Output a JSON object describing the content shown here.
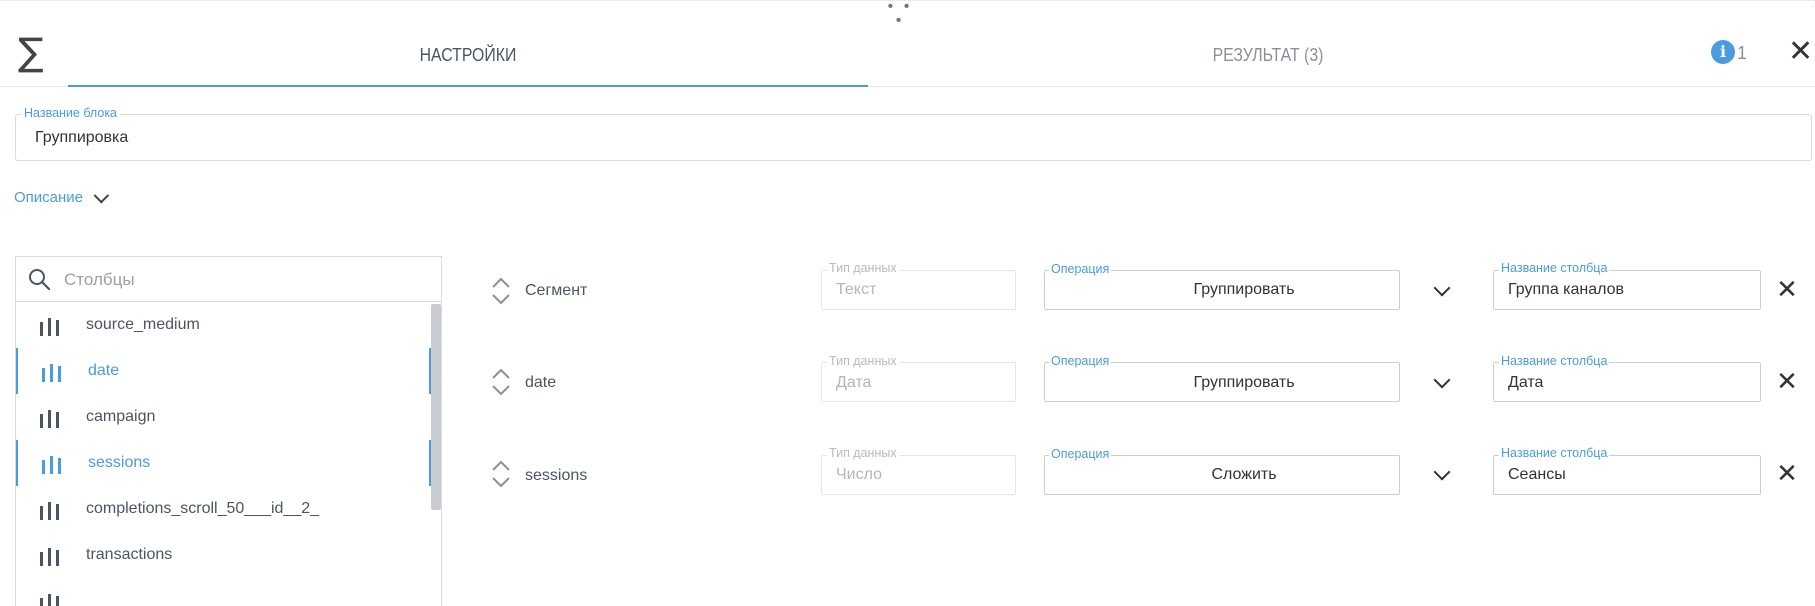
{
  "header": {
    "drag_handle": "• • •",
    "sigma_symbol": "∑",
    "tabs": [
      {
        "label": "НАСТРОЙКИ",
        "active": true
      },
      {
        "label": "РЕЗУЛЬТАТ (3)",
        "active": false
      }
    ],
    "info_count": "1",
    "close_symbol": "✕"
  },
  "block_name": {
    "label": "Название блока",
    "value": "Группировка"
  },
  "description": {
    "label": "Описание"
  },
  "columns": {
    "placeholder": "Столбцы",
    "items": [
      {
        "label": "source_medium",
        "selected": false
      },
      {
        "label": "date",
        "selected": true
      },
      {
        "label": "campaign",
        "selected": false
      },
      {
        "label": "sessions",
        "selected": true
      },
      {
        "label": "completions_scroll_50___id__2_",
        "selected": false
      },
      {
        "label": "transactions",
        "selected": false
      }
    ]
  },
  "rows": [
    {
      "name": "Сегмент",
      "dtype_label": "Тип данных",
      "dtype": "Текст",
      "op_label": "Операция",
      "operation": "Группировать",
      "col_label": "Название столбца",
      "col_name": "Группа каналов"
    },
    {
      "name": "date",
      "dtype_label": "Тип данных",
      "dtype": "Дата",
      "op_label": "Операция",
      "operation": "Группировать",
      "col_label": "Название столбца",
      "col_name": "Дата"
    },
    {
      "name": "sessions",
      "dtype_label": "Тип данных",
      "dtype": "Число",
      "op_label": "Операция",
      "operation": "Сложить",
      "col_label": "Название столбца",
      "col_name": "Сеансы"
    }
  ],
  "colors": {
    "accent": "#4a9be0",
    "text": "#4a5563",
    "muted": "#b0b6bc"
  }
}
